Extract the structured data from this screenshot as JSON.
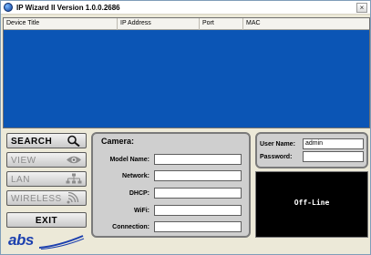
{
  "window": {
    "title": "IP Wizard II  Version 1.0.0.2686",
    "close_label": "×"
  },
  "device_list": {
    "columns": [
      "Device Title",
      "IP Address",
      "Port",
      "MAC"
    ]
  },
  "nav": {
    "items": [
      {
        "label": "SEARCH",
        "icon": "magnifier-icon",
        "active": true
      },
      {
        "label": "VIEW",
        "icon": "eye-icon",
        "active": false
      },
      {
        "label": "LAN",
        "icon": "network-icon",
        "active": false
      },
      {
        "label": "WIRELESS",
        "icon": "wireless-icon",
        "active": false
      },
      {
        "label": "EXIT",
        "icon": "",
        "active": true
      }
    ]
  },
  "camera": {
    "title": "Camera:",
    "fields": [
      {
        "label": "Model Name:",
        "value": ""
      },
      {
        "label": "Network:",
        "value": ""
      },
      {
        "label": "DHCP:",
        "value": ""
      },
      {
        "label": "WiFi:",
        "value": ""
      },
      {
        "label": "Connection:",
        "value": ""
      }
    ]
  },
  "login": {
    "user_label": "User Name:",
    "user_value": "admin",
    "password_label": "Password:",
    "password_value": ""
  },
  "status": {
    "text": "Off-Line"
  },
  "logo": {
    "text": "abs",
    "color": "#1b3fae"
  },
  "colors": {
    "list_background": "#0b55b5",
    "panel_background": "#cfcfcf"
  }
}
